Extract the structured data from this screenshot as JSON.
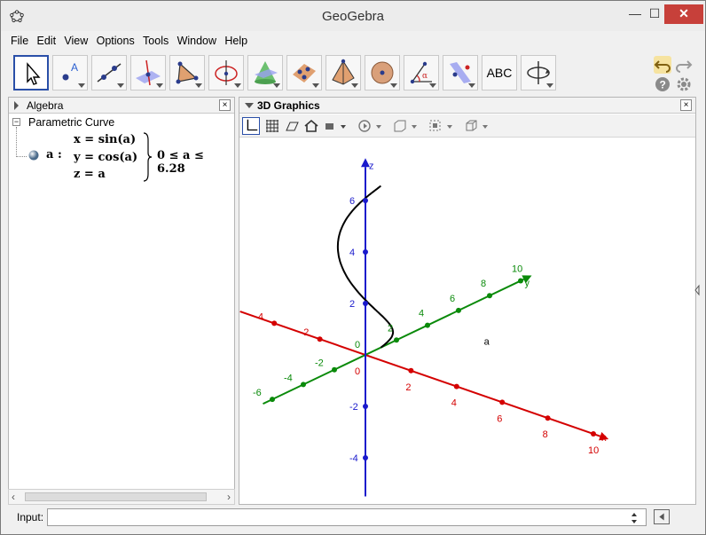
{
  "window": {
    "title": "GeoGebra",
    "minimize": "—",
    "maximize": "☐",
    "close": "✕"
  },
  "menu": [
    "File",
    "Edit",
    "View",
    "Options",
    "Tools",
    "Window",
    "Help"
  ],
  "toolbar": {
    "tools": [
      "move-tool",
      "point-tool",
      "line-tool",
      "perpendicular-tool",
      "polygon-tool",
      "circle-tool",
      "intersect-surfaces-tool",
      "plane-tool",
      "pyramid-tool",
      "sphere-tool",
      "angle-tool",
      "reflect-tool",
      "text-tool",
      "rotate-view-tool"
    ],
    "text_tool_label": "ABC"
  },
  "algebra": {
    "title": "Algebra",
    "group_label": "Parametric Curve",
    "object_name": "a :",
    "eq_x": "x = sin(a)",
    "eq_y": "y = cos(a)",
    "eq_z": "z = a",
    "condition": "0 ≤ a ≤ 6.28"
  },
  "graphics": {
    "title": "3D Graphics",
    "axes": {
      "x": "x",
      "y": "y",
      "z": "z"
    },
    "x_ticks": [
      "-4",
      "-2",
      "0",
      "2",
      "4",
      "6",
      "8",
      "10"
    ],
    "y_ticks": [
      "-6",
      "-4",
      "-2",
      "0",
      "2",
      "4",
      "6",
      "8",
      "10"
    ],
    "z_ticks": [
      "-4",
      "-2",
      "2",
      "4",
      "6"
    ],
    "curve_label": "a",
    "colors": {
      "x_axis": "#d40000",
      "y_axis": "#0a8a0a",
      "z_axis": "#1a1acc",
      "curve": "#000000"
    }
  },
  "input": {
    "label": "Input:",
    "value": "",
    "placeholder": ""
  }
}
